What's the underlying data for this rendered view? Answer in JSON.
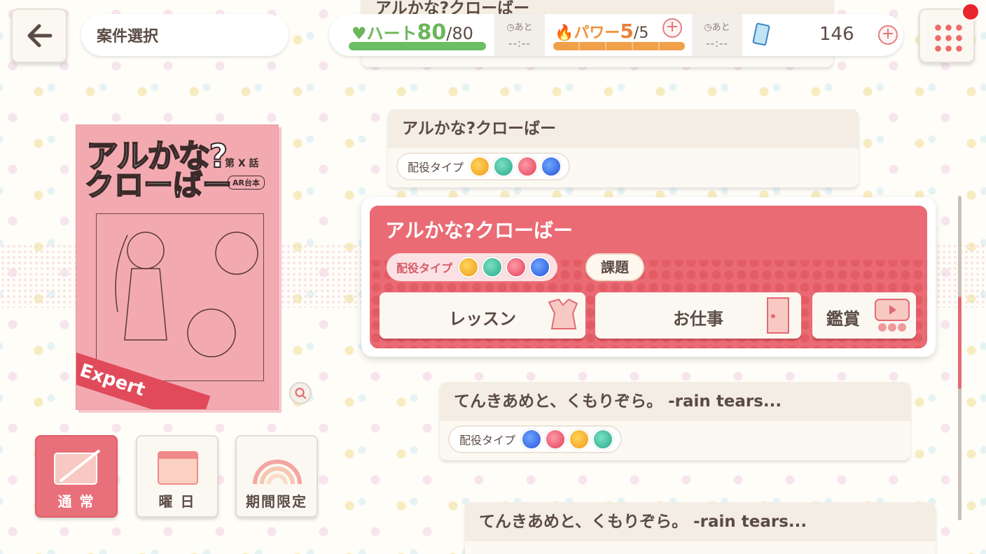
{
  "header": {
    "title": "案件選択",
    "back_icon": "arrow-left-icon"
  },
  "status": {
    "heart_label": "ハート",
    "heart_value": "80",
    "heart_max": "/80",
    "heart_fill": 1.0,
    "timer_label": "あと",
    "timer_value": "--:--",
    "power_label": "パワー",
    "power_value": "5",
    "power_max": "/5",
    "power_fill": 1.0,
    "ticket_count": "146"
  },
  "script_card": {
    "title_line1": "アルかな?",
    "title_line2": "クローばー",
    "episode": "第 X 話",
    "ar_label": "AR台本",
    "difficulty": "Expert"
  },
  "modes": [
    {
      "label": "通 常",
      "active": true
    },
    {
      "label": "曜 日",
      "active": false
    },
    {
      "label": "期間限定",
      "active": false
    }
  ],
  "jobs": {
    "top_partial_title": "アルかな?クローばー",
    "role_label": "配役タイプ",
    "item1": {
      "title": "アルかな?クローばー",
      "types": [
        "moon",
        "star",
        "sun",
        "snow"
      ]
    },
    "selected": {
      "title": "アルかな?クローばー",
      "types": [
        "moon",
        "star",
        "sun",
        "snow"
      ],
      "task_label": "課題",
      "lesson_label": "レッスン",
      "work_label": "お仕事",
      "view_label": "鑑賞"
    },
    "item2": {
      "title": "てんきあめと、くもりぞら。 -rain tears...",
      "types": [
        "snow",
        "sun",
        "moon",
        "star"
      ]
    },
    "item3": {
      "title": "てんきあめと、くもりぞら。 -rain tears..."
    }
  },
  "colors": {
    "accent": "#ea6b74",
    "heart": "#6abe63",
    "power": "#f1a04a"
  }
}
